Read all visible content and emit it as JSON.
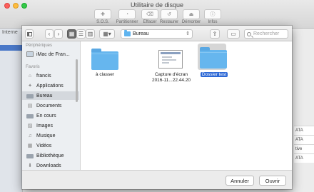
{
  "disk_utility": {
    "title": "Utilitaire de disque",
    "toolbar": [
      {
        "label": "S.O.S.",
        "icon": "stethoscope-icon",
        "glyph": "✚"
      },
      {
        "label": "Partitionner",
        "icon": "partition-icon",
        "glyph": "◔"
      },
      {
        "label": "Effacer",
        "icon": "erase-icon",
        "glyph": "⌫"
      },
      {
        "label": "Restaurer",
        "icon": "restore-icon",
        "glyph": "↺"
      },
      {
        "label": "Démonter",
        "icon": "eject-icon",
        "glyph": "⏏"
      },
      {
        "label": "Infos",
        "icon": "info-icon",
        "glyph": "ⓘ"
      }
    ],
    "sidebar_heading": "Interne",
    "cells": [
      "ATA",
      "ATA",
      "tive",
      "ATA"
    ]
  },
  "dialog": {
    "location": "Bureau",
    "search_placeholder": "Rechercher",
    "sidebar": {
      "devices_heading": "Périphériques",
      "devices": [
        {
          "label": "iMac de Fran...",
          "icon": "imac-icon"
        }
      ],
      "favorites_heading": "Favoris",
      "favorites": [
        {
          "label": "francis",
          "icon": "home-icon",
          "glyph": "⌂"
        },
        {
          "label": "Applications",
          "icon": "applications-icon",
          "glyph": "✦"
        },
        {
          "label": "Bureau",
          "icon": "desktop-folder-icon",
          "glyph": ""
        },
        {
          "label": "Documents",
          "icon": "documents-icon",
          "glyph": "▤"
        },
        {
          "label": "En cours",
          "icon": "folder-icon",
          "glyph": ""
        },
        {
          "label": "Images",
          "icon": "images-icon",
          "glyph": "▨"
        },
        {
          "label": "Musique",
          "icon": "music-icon",
          "glyph": "♫"
        },
        {
          "label": "Vidéos",
          "icon": "movies-icon",
          "glyph": "▦"
        },
        {
          "label": "Bibliothèque",
          "icon": "library-folder-icon",
          "glyph": ""
        },
        {
          "label": "Downloads",
          "icon": "downloads-icon",
          "glyph": "⬇"
        }
      ],
      "selected": "Bureau"
    },
    "files": [
      {
        "name": "à classer",
        "kind": "folder"
      },
      {
        "name_line1": "Capture d'écran",
        "name_line2": "2016-11...22.44.20",
        "kind": "screenshot"
      },
      {
        "name": "Dossier test",
        "kind": "folder",
        "selected": true
      }
    ],
    "buttons": {
      "cancel": "Annuler",
      "open": "Ouvrir"
    }
  },
  "colors": {
    "accent": "#2c68d6",
    "folder": "#66b6ee"
  }
}
